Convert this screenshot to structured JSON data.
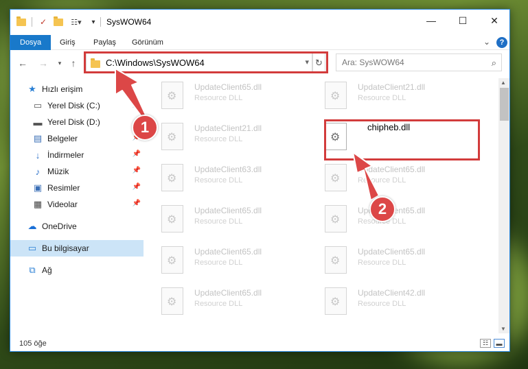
{
  "window": {
    "title": "SysWOW64"
  },
  "ribbon": {
    "tabs": [
      "Dosya",
      "Giriş",
      "Paylaş",
      "Görünüm"
    ]
  },
  "address": {
    "path": "C:\\Windows\\SysWOW64",
    "search_placeholder": "Ara: SysWOW64"
  },
  "nav": {
    "items": [
      {
        "label": "Hızlı erişim",
        "icon": "star-icon"
      },
      {
        "label": "Yerel Disk (C:)",
        "icon": "drive-icon"
      },
      {
        "label": "Yerel Disk (D:)",
        "icon": "drive-icon"
      },
      {
        "label": "Belgeler",
        "icon": "document-icon"
      },
      {
        "label": "İndirmeler",
        "icon": "download-icon"
      },
      {
        "label": "Müzik",
        "icon": "music-icon"
      },
      {
        "label": "Resimler",
        "icon": "pictures-icon"
      },
      {
        "label": "Videolar",
        "icon": "video-icon"
      },
      {
        "label": "OneDrive",
        "icon": "cloud-icon"
      },
      {
        "label": "Bu bilgisayar",
        "icon": "computer-icon"
      },
      {
        "label": "Ağ",
        "icon": "network-icon"
      }
    ]
  },
  "files": {
    "left": [
      {
        "name": "UpdateClient65.dll",
        "type": "Resource DLL"
      },
      {
        "name": "UpdateClient21.dll",
        "type": "Resource DLL"
      },
      {
        "name": "UpdateClient63.dll",
        "type": "Resource DLL"
      },
      {
        "name": "UpdateClient65.dll",
        "type": "Resource DLL"
      },
      {
        "name": "UpdateClient65.dll",
        "type": "Resource DLL"
      },
      {
        "name": "UpdateClient65.dll",
        "type": "Resource DLL"
      }
    ],
    "right": [
      {
        "name": "UpdateClient21.dll",
        "type": "Resource DLL"
      },
      {
        "name": "chipheb.dll",
        "type": ""
      },
      {
        "name": "UpdateClient65.dll",
        "type": "Resource DLL"
      },
      {
        "name": "UpdateClient65.dll",
        "type": "Resource DLL"
      },
      {
        "name": "UpdateClient65.dll",
        "type": "Resource DLL"
      },
      {
        "name": "UpdateClient42.dll",
        "type": "Resource DLL"
      }
    ]
  },
  "status": {
    "count": "105 öğe"
  },
  "annotations": {
    "step1": "1",
    "step2": "2"
  },
  "colors": {
    "accent": "#1979ca",
    "highlight_box": "#d23b3b",
    "badge": "#dc4747",
    "selection": "#cce4f7"
  }
}
